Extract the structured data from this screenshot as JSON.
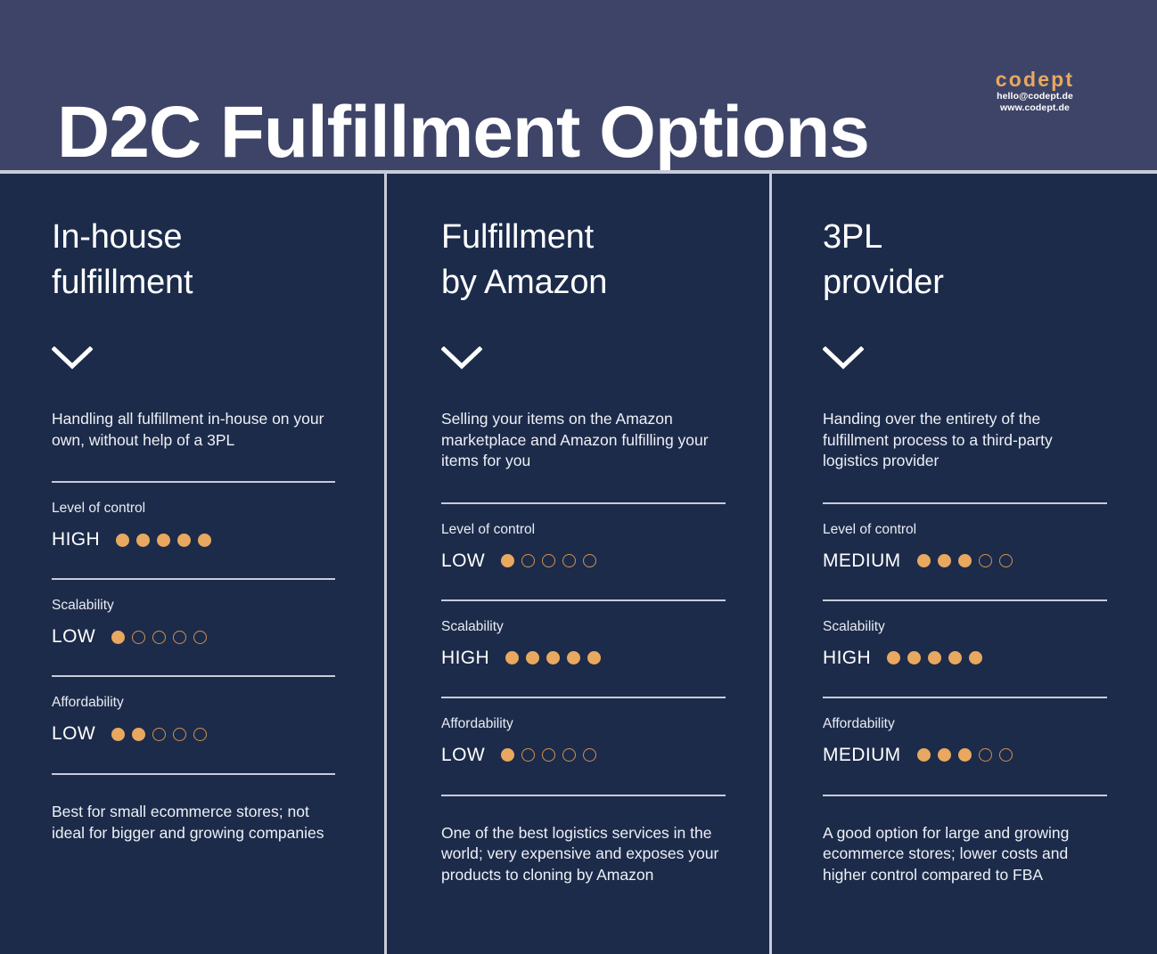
{
  "header": {
    "title": "D2C Fulfillment Options",
    "logo": {
      "word": "codept",
      "email": "hello@codept.de",
      "website": "www.codept.de"
    },
    "bg_color": "#3e4468"
  },
  "theme": {
    "page_bg": "#1c2b4a",
    "accent": "#e9a85f",
    "rule": "#c9cbd8",
    "text": "#ffffff"
  },
  "metric_labels": {
    "control": "Level of control",
    "scalability": "Scalability",
    "affordability": "Affordability"
  },
  "columns": [
    {
      "title_line1": "In-house",
      "title_line2": "fulfillment",
      "chevron_icon": "chevron-down-icon",
      "intro": "Handling all fulfillment in-house on your own, without help of a 3PL",
      "metrics": [
        {
          "label": "Level of control",
          "value": "HIGH",
          "rating": 5,
          "max": 5
        },
        {
          "label": "Scalability",
          "value": "LOW",
          "rating": 1,
          "max": 5
        },
        {
          "label": "Affordability",
          "value": "LOW",
          "rating": 2,
          "max": 5
        }
      ],
      "footnote": "Best for small ecommerce stores; not ideal for bigger and growing companies"
    },
    {
      "title_line1": "Fulfillment",
      "title_line2": "by Amazon",
      "chevron_icon": "chevron-down-icon",
      "intro": "Selling your items on the Amazon marketplace and Amazon fulfilling your items for you",
      "metrics": [
        {
          "label": "Level of control",
          "value": "LOW",
          "rating": 1,
          "max": 5
        },
        {
          "label": "Scalability",
          "value": "HIGH",
          "rating": 5,
          "max": 5
        },
        {
          "label": "Affordability",
          "value": "LOW",
          "rating": 1,
          "max": 5
        }
      ],
      "footnote": "One of the best logistics services in the world; very expensive and exposes your products to cloning by Amazon"
    },
    {
      "title_line1": "3PL",
      "title_line2": "provider",
      "chevron_icon": "chevron-down-icon",
      "intro": "Handing over the entirety of the fulfillment process to a third-party logistics provider",
      "metrics": [
        {
          "label": "Level of control",
          "value": "MEDIUM",
          "rating": 3,
          "max": 5
        },
        {
          "label": "Scalability",
          "value": "HIGH",
          "rating": 5,
          "max": 5
        },
        {
          "label": "Affordability",
          "value": "MEDIUM",
          "rating": 3,
          "max": 5
        }
      ],
      "footnote": "A good option for large and growing ecommerce stores; lower costs and higher control compared to FBA"
    }
  ]
}
